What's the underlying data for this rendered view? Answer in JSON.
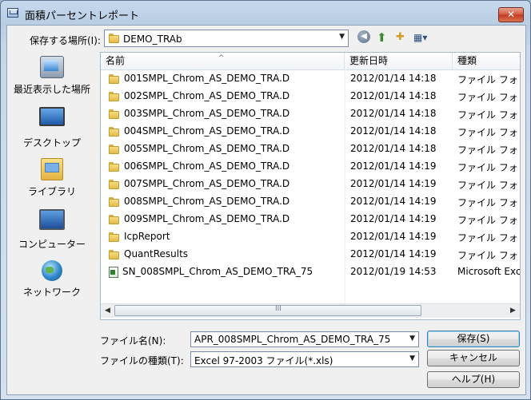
{
  "window": {
    "title": "面積パーセントレポート",
    "close_glyph": "✕"
  },
  "location": {
    "label": "保存する場所(I):",
    "value": "DEMO_TRAb"
  },
  "toolbar": {
    "back_glyph": "◀",
    "up_glyph": "⬆",
    "newfolder_glyph": "✚",
    "views_glyph": "▦▾"
  },
  "places": [
    {
      "label": "最近表示した場所",
      "icon": "recent-places-icon"
    },
    {
      "label": "デスクトップ",
      "icon": "desktop-icon"
    },
    {
      "label": "ライブラリ",
      "icon": "library-icon"
    },
    {
      "label": "コンピューター",
      "icon": "computer-icon"
    },
    {
      "label": "ネットワーク",
      "icon": "network-icon"
    }
  ],
  "columns": {
    "name": "名前",
    "date": "更新日時",
    "type": "種類"
  },
  "files": [
    {
      "name": "001SMPL_Chrom_AS_DEMO_TRA.D",
      "date": "2012/01/14 14:18",
      "type": "ファイル フォ",
      "icon": "folder-icon"
    },
    {
      "name": "002SMPL_Chrom_AS_DEMO_TRA.D",
      "date": "2012/01/14 14:18",
      "type": "ファイル フォ",
      "icon": "folder-icon"
    },
    {
      "name": "003SMPL_Chrom_AS_DEMO_TRA.D",
      "date": "2012/01/14 14:18",
      "type": "ファイル フォ",
      "icon": "folder-icon"
    },
    {
      "name": "004SMPL_Chrom_AS_DEMO_TRA.D",
      "date": "2012/01/14 14:18",
      "type": "ファイル フォ",
      "icon": "folder-icon"
    },
    {
      "name": "005SMPL_Chrom_AS_DEMO_TRA.D",
      "date": "2012/01/14 14:18",
      "type": "ファイル フォ",
      "icon": "folder-icon"
    },
    {
      "name": "006SMPL_Chrom_AS_DEMO_TRA.D",
      "date": "2012/01/14 14:19",
      "type": "ファイル フォ",
      "icon": "folder-icon"
    },
    {
      "name": "007SMPL_Chrom_AS_DEMO_TRA.D",
      "date": "2012/01/14 14:19",
      "type": "ファイル フォ",
      "icon": "folder-icon"
    },
    {
      "name": "008SMPL_Chrom_AS_DEMO_TRA.D",
      "date": "2012/01/14 14:19",
      "type": "ファイル フォ",
      "icon": "folder-icon"
    },
    {
      "name": "009SMPL_Chrom_AS_DEMO_TRA.D",
      "date": "2012/01/14 14:19",
      "type": "ファイル フォ",
      "icon": "folder-icon"
    },
    {
      "name": "IcpReport",
      "date": "2012/01/14 14:19",
      "type": "ファイル フォ",
      "icon": "folder-icon"
    },
    {
      "name": "QuantResults",
      "date": "2012/01/14 14:19",
      "type": "ファイル フォ",
      "icon": "folder-icon"
    },
    {
      "name": "SN_008SMPL_Chrom_AS_DEMO_TRA_75",
      "date": "2012/01/19 14:53",
      "type": "Microsoft Exc",
      "icon": "excel-file-icon"
    }
  ],
  "scrollbar": {
    "left_glyph": "◀",
    "right_glyph": "▶",
    "grip_glyph": "III"
  },
  "filename": {
    "label": "ファイル名(N):",
    "value": "APR_008SMPL_Chrom_AS_DEMO_TRA_75"
  },
  "filetype": {
    "label": "ファイルの種類(T):",
    "value": "Excel 97-2003 ファイル(*.xls)"
  },
  "buttons": {
    "save": "保存(S)",
    "cancel": "キャンセル",
    "help": "ヘルプ(H)"
  }
}
